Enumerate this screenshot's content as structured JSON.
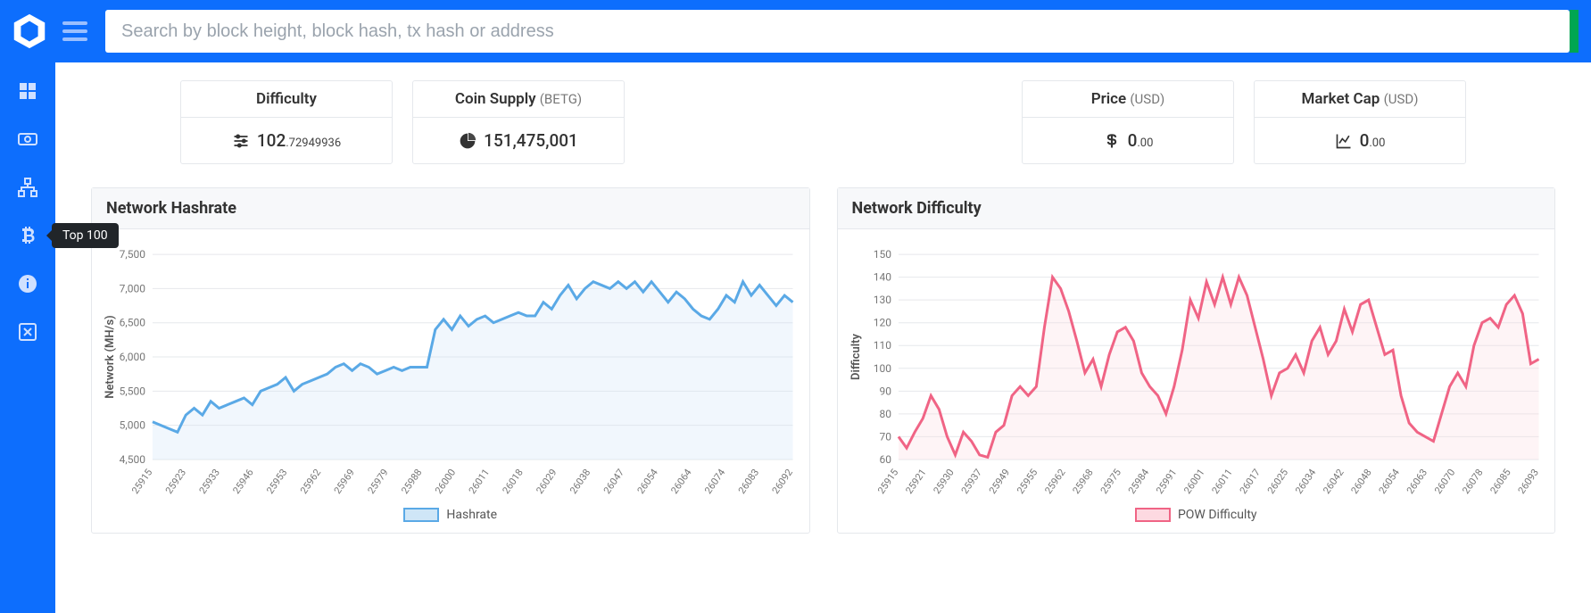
{
  "search": {
    "placeholder": "Search by block height, block hash, tx hash or address"
  },
  "tooltip": {
    "top100": "Top 100"
  },
  "cards": {
    "difficulty": {
      "title": "Difficulty",
      "value_int": "102",
      "value_dec": ".72949936"
    },
    "supply": {
      "title": "Coin Supply ",
      "sub": "(BETG)",
      "value": "151,475,001"
    },
    "price": {
      "title": "Price ",
      "sub": "(USD)",
      "value_int": "0",
      "value_dec": ".00"
    },
    "mcap": {
      "title": "Market Cap ",
      "sub": "(USD)",
      "value_int": "0",
      "value_dec": ".00"
    }
  },
  "colors": {
    "hashrate_stroke": "#5aa9e6",
    "hashrate_fill": "#cfe6f7",
    "difficulty_stroke": "#f06485",
    "difficulty_fill": "#fdd9e1"
  },
  "chart_data": [
    {
      "id": "hashrate",
      "type": "area",
      "title": "Network Hashrate",
      "ylabel": "Network (MH/s)",
      "legend": "Hashrate",
      "ylim": [
        4500,
        7500
      ],
      "yticks": [
        4500,
        5000,
        5500,
        6000,
        6500,
        7000,
        7500
      ],
      "xticks": [
        "25915",
        "25923",
        "25933",
        "25946",
        "25953",
        "25962",
        "25969",
        "25979",
        "25988",
        "26000",
        "26011",
        "26018",
        "26029",
        "26038",
        "26047",
        "26054",
        "26064",
        "26074",
        "26083",
        "26092"
      ],
      "values": [
        5050,
        5000,
        4950,
        4900,
        5150,
        5250,
        5150,
        5350,
        5250,
        5300,
        5350,
        5400,
        5300,
        5500,
        5550,
        5600,
        5700,
        5500,
        5600,
        5650,
        5700,
        5750,
        5850,
        5900,
        5800,
        5900,
        5850,
        5750,
        5800,
        5850,
        5800,
        5850,
        5850,
        5850,
        6400,
        6550,
        6400,
        6600,
        6450,
        6550,
        6600,
        6500,
        6550,
        6600,
        6650,
        6600,
        6600,
        6800,
        6700,
        6900,
        7050,
        6850,
        7000,
        7100,
        7050,
        7000,
        7100,
        7000,
        7100,
        6950,
        7100,
        6950,
        6800,
        6950,
        6850,
        6700,
        6600,
        6550,
        6700,
        6900,
        6800,
        7100,
        6900,
        7050,
        6900,
        6750,
        6900,
        6800
      ]
    },
    {
      "id": "difficulty",
      "type": "area",
      "title": "Network Difficulty",
      "ylabel": "Difficulty",
      "legend": "POW Difficulty",
      "ylim": [
        60,
        150
      ],
      "yticks": [
        60,
        70,
        80,
        90,
        100,
        110,
        120,
        130,
        140,
        150
      ],
      "xticks": [
        "25915",
        "25921",
        "25930",
        "25937",
        "25949",
        "25955",
        "25962",
        "25968",
        "25975",
        "25984",
        "25991",
        "26001",
        "26011",
        "26017",
        "26025",
        "26034",
        "26042",
        "26048",
        "26054",
        "26063",
        "26070",
        "26078",
        "26085",
        "26093"
      ],
      "values": [
        70,
        65,
        72,
        78,
        88,
        82,
        70,
        62,
        72,
        68,
        62,
        61,
        72,
        75,
        88,
        92,
        88,
        92,
        118,
        140,
        135,
        125,
        112,
        98,
        104,
        92,
        106,
        116,
        118,
        112,
        98,
        92,
        88,
        80,
        92,
        108,
        130,
        122,
        138,
        128,
        140,
        128,
        140,
        132,
        118,
        104,
        88,
        98,
        100,
        106,
        98,
        112,
        118,
        106,
        112,
        126,
        116,
        128,
        130,
        118,
        106,
        108,
        88,
        76,
        72,
        70,
        68,
        80,
        92,
        98,
        92,
        110,
        120,
        122,
        118,
        128,
        132,
        124,
        102,
        104
      ]
    }
  ]
}
